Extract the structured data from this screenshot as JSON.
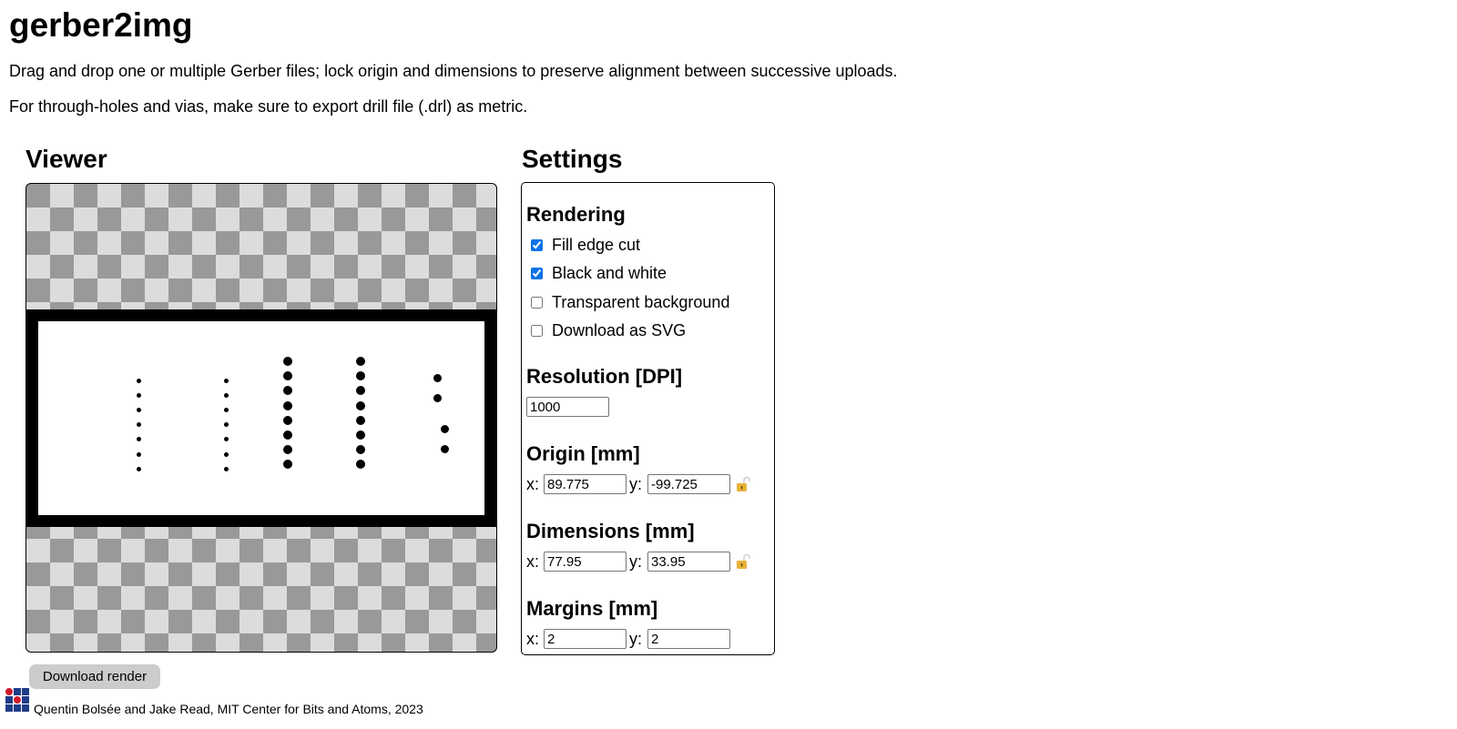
{
  "page": {
    "title": "gerber2img",
    "intro_lines": [
      "Drag and drop one or multiple Gerber files; lock origin and dimensions to preserve alignment between successive uploads.",
      "For through-holes and vias, make sure to export drill file (.drl) as metric."
    ]
  },
  "viewer": {
    "title": "Viewer",
    "download_label": "Download render",
    "render": {
      "background": "transparent-checkerboard",
      "edge_cut_color": "#000000",
      "board_color": "#ffffff",
      "hole_color": "#000000",
      "hole_columns": [
        {
          "count": 7,
          "size": "small"
        },
        {
          "count": 7,
          "size": "small"
        },
        {
          "count": 8,
          "size": "large"
        },
        {
          "count": 8,
          "size": "large"
        },
        {
          "count": 4,
          "size": "medium"
        }
      ]
    }
  },
  "settings": {
    "title": "Settings",
    "rendering": {
      "title": "Rendering",
      "options": [
        {
          "label": "Fill edge cut",
          "checked": true
        },
        {
          "label": "Black and white",
          "checked": true
        },
        {
          "label": "Transparent background",
          "checked": false
        },
        {
          "label": "Download as SVG",
          "checked": false
        }
      ]
    },
    "resolution": {
      "title": "Resolution [DPI]",
      "value": "1000"
    },
    "origin": {
      "title": "Origin [mm]",
      "x_label": "x:",
      "y_label": "y:",
      "x": "89.775",
      "y": "-99.725",
      "lock_icon": "unlocked-padlock-icon",
      "locked": false
    },
    "dimensions": {
      "title": "Dimensions [mm]",
      "x_label": "x:",
      "y_label": "y:",
      "x": "77.95",
      "y": "33.95",
      "lock_icon": "unlocked-padlock-icon",
      "locked": false
    },
    "margins": {
      "title": "Margins [mm]",
      "x_label": "x:",
      "y_label": "y:",
      "x": "2",
      "y": "2"
    }
  },
  "footer": {
    "logo": "cba-logo-icon",
    "credit": "Quentin Bolsée and Jake Read, MIT Center for Bits and Atoms, 2023"
  },
  "colors": {
    "checker_light": "#dcdcdc",
    "checker_dark": "#999999",
    "checkbox_accent": "#0b72e7",
    "lock_color": "#e8b339",
    "button_bg": "#cccccc",
    "logo_blue": "#1f3c88",
    "logo_red": "#d11a2a"
  }
}
